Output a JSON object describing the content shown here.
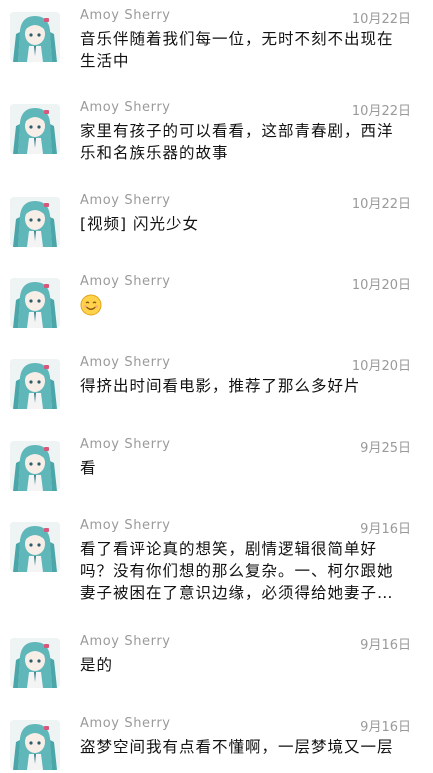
{
  "comments": [
    {
      "author": "Amoy Sherry",
      "date": "10月22日",
      "text": "音乐伴随着我们每一位，无时不刻不出现在生活中"
    },
    {
      "author": "Amoy Sherry",
      "date": "10月22日",
      "text": "家里有孩子的可以看看，这部青春剧，西洋乐和名族乐器的故事"
    },
    {
      "author": "Amoy Sherry",
      "date": "10月22日",
      "text": "[视频] 闪光少女"
    },
    {
      "author": "Amoy Sherry",
      "date": "10月20日",
      "text": "",
      "emoji": "smile-emoji"
    },
    {
      "author": "Amoy Sherry",
      "date": "10月20日",
      "text": "得挤出时间看电影，推荐了那么多好片"
    },
    {
      "author": "Amoy Sherry",
      "date": "9月25日",
      "text": "看"
    },
    {
      "author": "Amoy Sherry",
      "date": "9月16日",
      "text": "看了看评论真的想笑，剧情逻辑很简单好吗？没有你们想的那么复杂。一、柯尔跟她妻子被困在了意识边缘，必须得给她妻子…"
    },
    {
      "author": "Amoy Sherry",
      "date": "9月16日",
      "text": "是的"
    },
    {
      "author": "Amoy Sherry",
      "date": "9月16日",
      "text": "盗梦空间我有点看不懂啊，一层梦境又一层"
    }
  ],
  "colors": {
    "meta": "#9a9a9a",
    "text": "#111111",
    "avatar_hair": "#5fb7b9"
  }
}
